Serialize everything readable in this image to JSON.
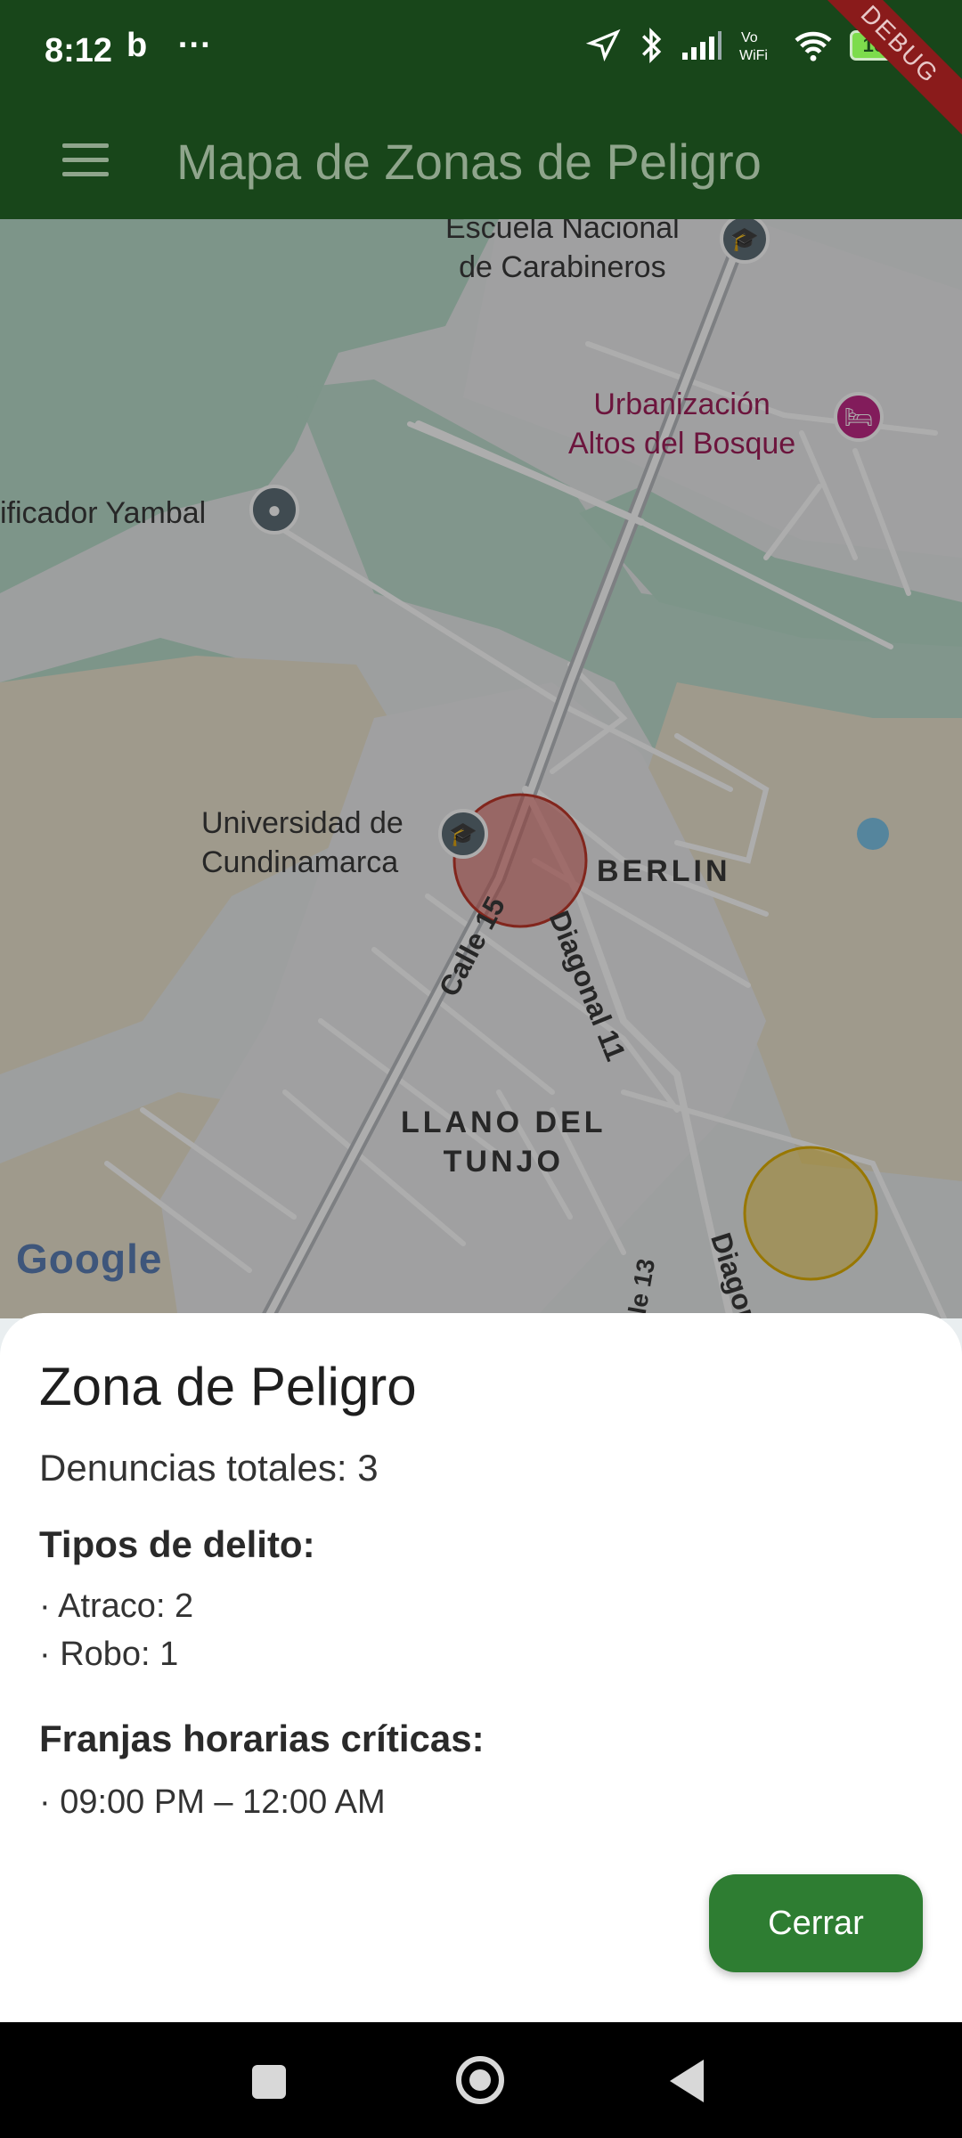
{
  "status_bar": {
    "time": "8:12",
    "left_icons": [
      "b",
      "···"
    ],
    "battery": "100"
  },
  "debug_ribbon": "DEBUG",
  "app_bar": {
    "title": "Mapa de Zonas de Peligro"
  },
  "map": {
    "labels": {
      "escuela": "Escuela Nacional\nde Carabineros",
      "urbanizacion": "Urbanización\nAltos del Bosque",
      "yambal": "ificador Yambal",
      "universidad": "Universidad de\nCundinamarca",
      "berlin": "BERLIN",
      "calle15": "Calle 15",
      "diagonal11": "Diagonal 11",
      "llano": "LLANO DEL\nTUNJO",
      "calle13": "le 13",
      "diagonal_bottom": "Diagon"
    },
    "attribution": "Google"
  },
  "sheet": {
    "title": "Zona de Peligro",
    "total": "Denuncias totales: 3",
    "types_heading": "Tipos de delito:",
    "types": [
      "· Atraco: 2",
      "· Robo: 1"
    ],
    "hours_heading": "Franjas horarias críticas:",
    "hours": [
      "· 09:00 PM – 12:00 AM"
    ],
    "close_label": "Cerrar"
  },
  "colors": {
    "app_bar": "#18461a",
    "button": "#2e7d32",
    "danger_zone": "#d9534f",
    "warning_zone": "#f2c21b"
  }
}
